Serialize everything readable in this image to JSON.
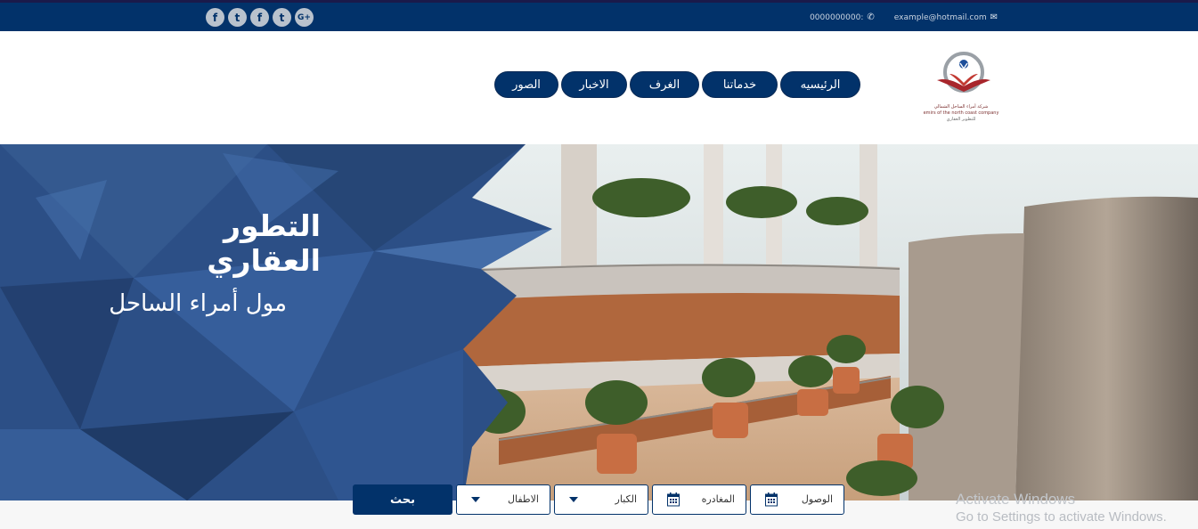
{
  "topbar": {
    "social": [
      {
        "icon": "facebook-icon",
        "glyph": "f"
      },
      {
        "icon": "twitter-icon",
        "glyph": "t"
      },
      {
        "icon": "facebook-icon",
        "glyph": "f"
      },
      {
        "icon": "twitter-icon",
        "glyph": "t"
      },
      {
        "icon": "google-plus-icon",
        "glyph": "G+"
      }
    ],
    "phone": "0000000000:",
    "email": "example@hotmail.com"
  },
  "nav": {
    "items": [
      "الصور",
      "الاخبار",
      "الغرف",
      "خدماتنا",
      "الرئيسيه"
    ]
  },
  "logo": {
    "line1": "شركة أمراء الساحل الشمالي",
    "line2": "emirs of the north coast company",
    "line3": "للتطوير العقاري"
  },
  "hero": {
    "title": "التطور العقاري",
    "subtitle": "مول أمراء الساحل"
  },
  "search": {
    "button": "بحث",
    "children": "الاطفال",
    "adults": "الكبار",
    "departure": "المغادره",
    "arrival": "الوصول"
  },
  "watermark": {
    "title": "Activate Windows",
    "subtitle": "Go to Settings to activate Windows."
  },
  "colors": {
    "brand": "#02326a",
    "panel": "#2c4f86"
  }
}
